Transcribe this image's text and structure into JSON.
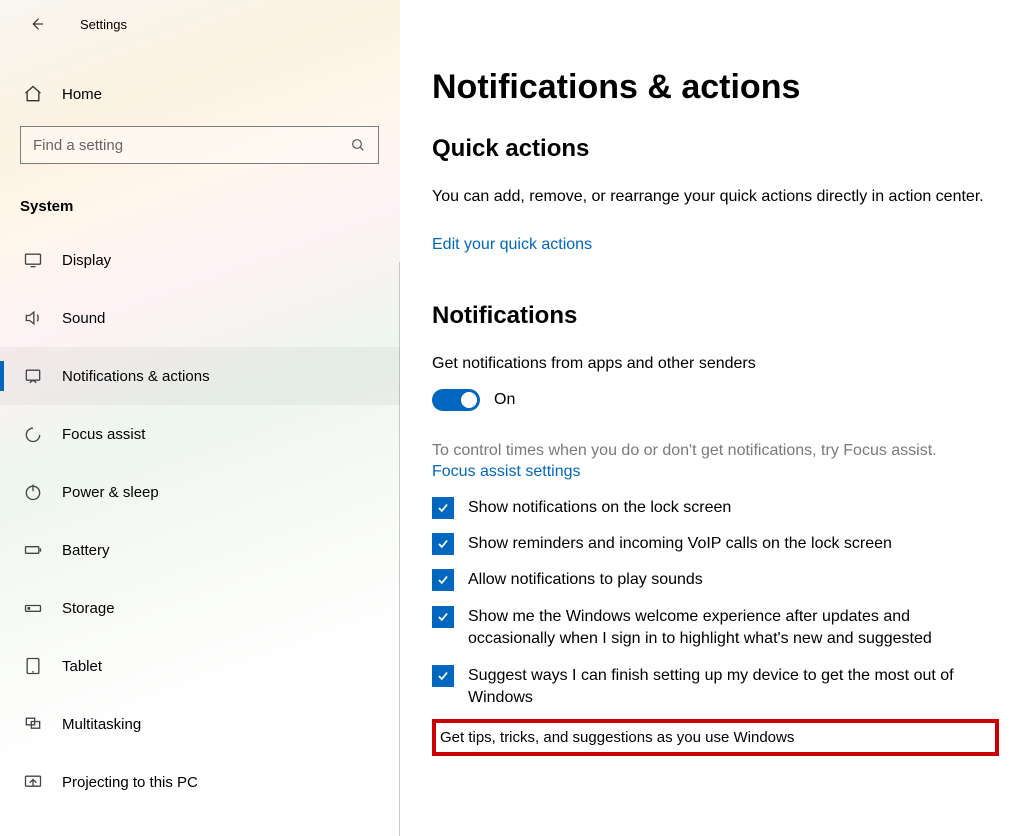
{
  "header": {
    "app_title": "Settings"
  },
  "sidebar": {
    "home_label": "Home",
    "search_placeholder": "Find a setting",
    "category": "System",
    "items": [
      {
        "label": "Display"
      },
      {
        "label": "Sound"
      },
      {
        "label": "Notifications & actions"
      },
      {
        "label": "Focus assist"
      },
      {
        "label": "Power & sleep"
      },
      {
        "label": "Battery"
      },
      {
        "label": "Storage"
      },
      {
        "label": "Tablet"
      },
      {
        "label": "Multitasking"
      },
      {
        "label": "Projecting to this PC"
      }
    ]
  },
  "main": {
    "page_title": "Notifications & actions",
    "quick_actions": {
      "heading": "Quick actions",
      "desc": "You can add, remove, or rearrange your quick actions directly in action center.",
      "link": "Edit your quick actions"
    },
    "notifications": {
      "heading": "Notifications",
      "toggle_caption": "Get notifications from apps and other senders",
      "toggle_state": "On",
      "focus_text": "To control times when you do or don't get notifications, try Focus assist.",
      "focus_link": "Focus assist settings",
      "checkboxes": [
        {
          "checked": true,
          "label": "Show notifications on the lock screen"
        },
        {
          "checked": true,
          "label": "Show reminders and incoming VoIP calls on the lock screen"
        },
        {
          "checked": true,
          "label": "Allow notifications to play sounds"
        },
        {
          "checked": true,
          "label": "Show me the Windows welcome experience after updates and occasionally when I sign in to highlight what's new and suggested"
        },
        {
          "checked": true,
          "label": "Suggest ways I can finish setting up my device to get the most out of Windows"
        },
        {
          "checked": false,
          "label": "Get tips, tricks, and suggestions as you use Windows"
        }
      ]
    }
  }
}
